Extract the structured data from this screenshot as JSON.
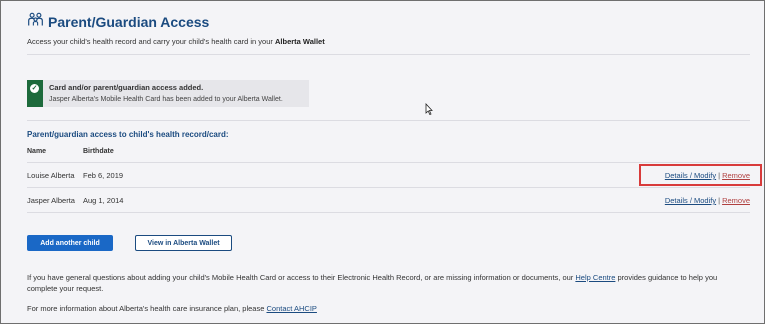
{
  "header": {
    "title": "Parent/Guardian Access",
    "subtitle_pre": "Access your child's health record and carry your child's health card in your ",
    "subtitle_bold": "Alberta Wallet"
  },
  "alert": {
    "title": "Card and/or parent/guardian access added.",
    "message": "Jasper Alberta's Mobile Health Card has been added to your Alberta Wallet.",
    "color": "#1d6a3c"
  },
  "access": {
    "section_title": "Parent/guardian access to child's health record/card:",
    "columns": {
      "name": "Name",
      "birthdate": "Birthdate"
    },
    "rows": [
      {
        "name": "Louise Alberta",
        "birthdate": "Feb 6, 2019",
        "details_label": "Details / Modify",
        "remove_label": "Remove",
        "highlighted": true
      },
      {
        "name": "Jasper Alberta",
        "birthdate": "Aug 1, 2014",
        "details_label": "Details / Modify",
        "remove_label": "Remove",
        "highlighted": false
      }
    ],
    "separator": "|"
  },
  "buttons": {
    "add_child": "Add another child",
    "view_wallet": "View in Alberta Wallet"
  },
  "footer": {
    "help_pre": "If you have general questions about adding your child's Mobile Health Card or access to their Electronic Health Record, or are missing information or documents, our ",
    "help_link": "Help Centre",
    "help_post": " provides guidance to help you complete your request.",
    "ahcip_pre": "For more information about Alberta's health care insurance plan, please ",
    "ahcip_link": "Contact AHCIP"
  },
  "colors": {
    "primary": "#1a68c6",
    "heading": "#1b4b80",
    "highlight": "#d83b3b"
  },
  "icons": {
    "header": "family-icon",
    "alert": "checkmark-icon",
    "cursor": "mouse-pointer-icon"
  }
}
